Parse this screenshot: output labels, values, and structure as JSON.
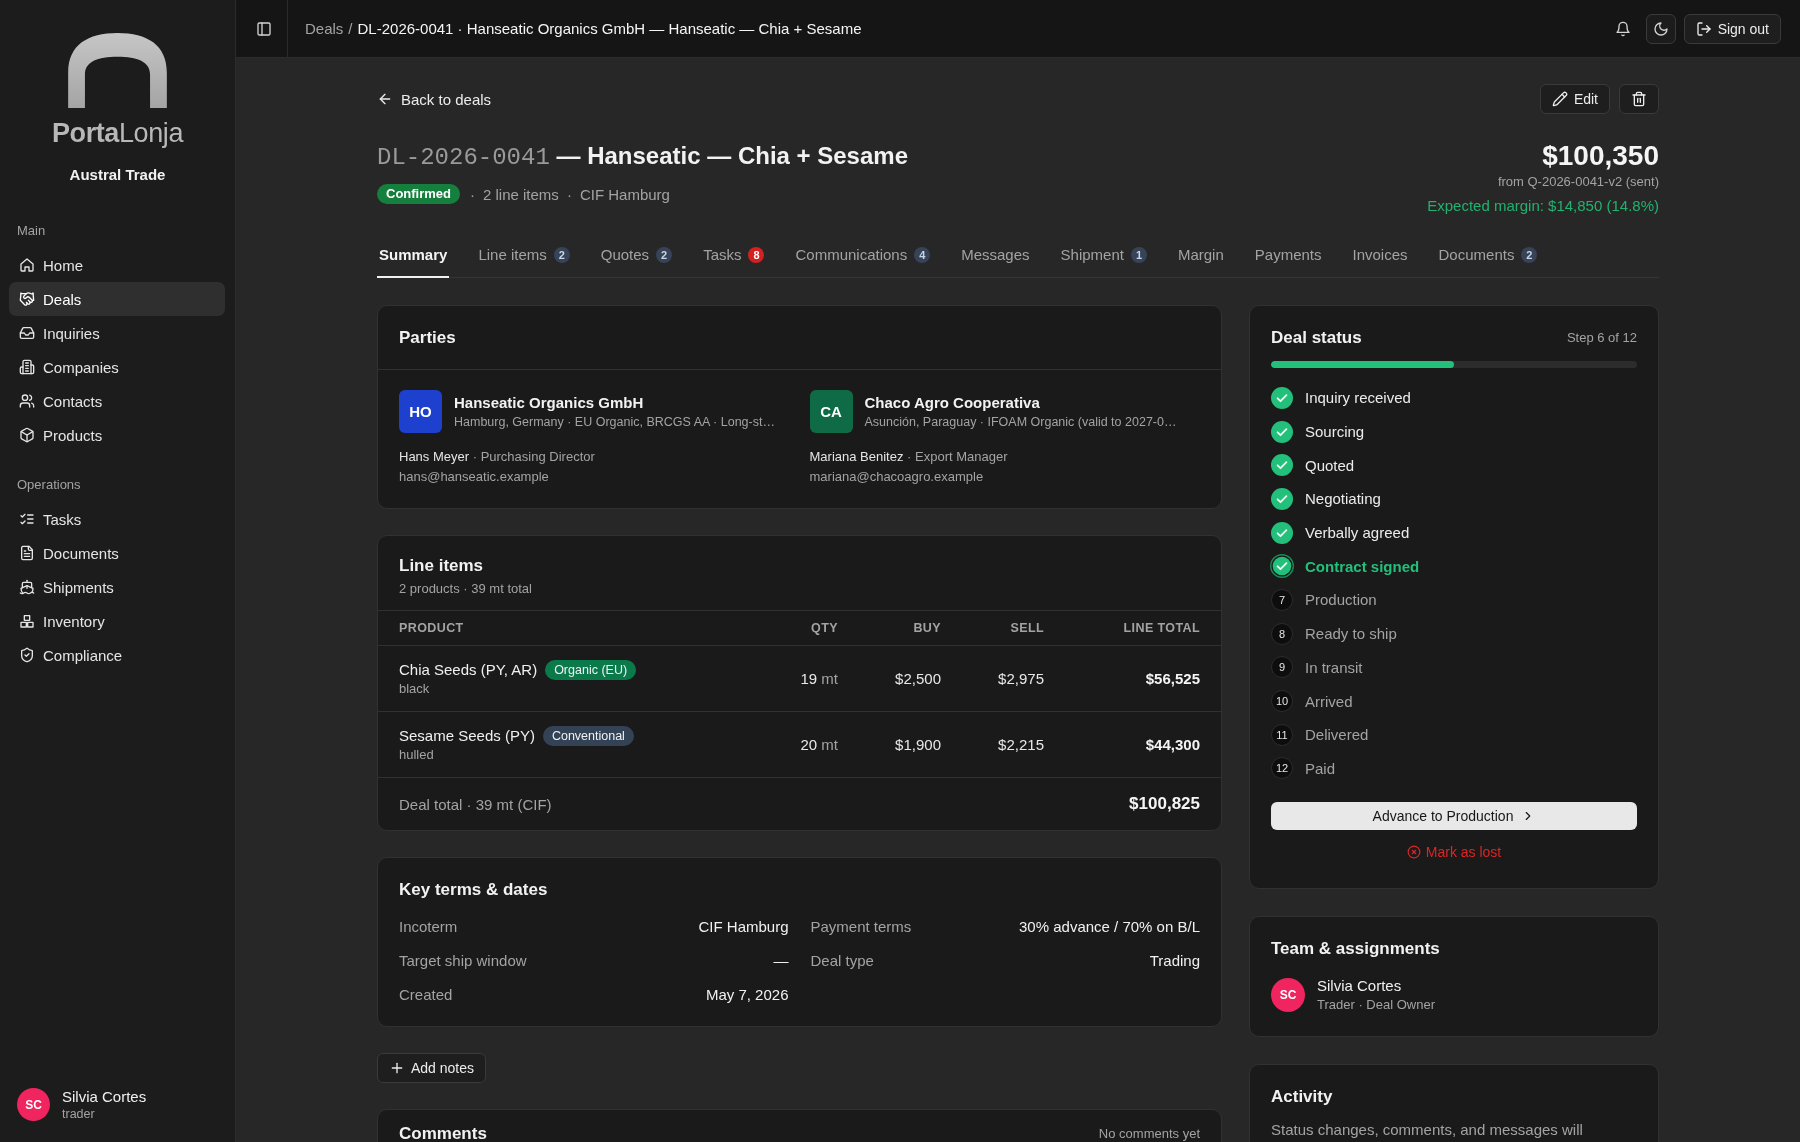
{
  "sidebar": {
    "logo": "**Porta**Lonja",
    "org": "Austral Trade",
    "sections": [
      {
        "title": "Main",
        "items": [
          {
            "label": "Home",
            "selected": false
          },
          {
            "label": "Deals",
            "selected": true
          },
          {
            "label": "Inquiries",
            "selected": false
          },
          {
            "label": "Companies",
            "selected": false
          },
          {
            "label": "Contacts",
            "selected": false
          },
          {
            "label": "Products",
            "selected": false
          }
        ]
      },
      {
        "title": "Operations",
        "items": [
          {
            "label": "Tasks",
            "selected": false
          },
          {
            "label": "Documents",
            "selected": false
          },
          {
            "label": "Shipments",
            "selected": false
          },
          {
            "label": "Inventory",
            "selected": false
          },
          {
            "label": "Compliance",
            "selected": false
          }
        ]
      }
    ],
    "user": {
      "initials": "SC",
      "color": "#f0245e",
      "name": "Silvia Cortes",
      "role": "trader"
    }
  },
  "header": {
    "breadcrumb": {
      "parent": "Deals",
      "separator": "/",
      "current": "DL-2026-0041 · Hanseatic Organics GmbH — Hanseatic — Chia + Sesame"
    },
    "sign_out": "Sign out"
  },
  "deal": {
    "back_link": "Back to deals",
    "edit_button": "Edit",
    "id": "DL-2026-0041",
    "title": "— Hanseatic — Chia + Sesame",
    "status": "Confirmed",
    "meta_separator": "·",
    "meta": [
      "2 line items",
      "CIF Hamburg"
    ],
    "amount": "$100,350",
    "amount_source": "from Q-2026-0041-v2 (sent)",
    "expected_margin": "Expected margin: $14,850 (14.8%)"
  },
  "tabs": [
    {
      "label": "Summary",
      "selected": true
    },
    {
      "label": "Line items",
      "count": "2",
      "count_alert": false,
      "selected": false
    },
    {
      "label": "Quotes",
      "count": "2",
      "count_alert": false,
      "selected": false
    },
    {
      "label": "Tasks",
      "count": "8",
      "count_alert": true,
      "selected": false
    },
    {
      "label": "Communications",
      "count": "4",
      "count_alert": false,
      "selected": false
    },
    {
      "label": "Messages",
      "selected": false
    },
    {
      "label": "Shipment",
      "count": "1",
      "count_alert": false,
      "selected": false
    },
    {
      "label": "Margin",
      "selected": false
    },
    {
      "label": "Payments",
      "selected": false
    },
    {
      "label": "Invoices",
      "selected": false
    },
    {
      "label": "Documents",
      "count": "2",
      "count_alert": false,
      "selected": false
    }
  ],
  "parties": {
    "title": "Parties",
    "items": [
      {
        "initials": "HO",
        "color": "#1e40cf",
        "name": "Hanseatic Organics GmbH",
        "details": "Hamburg, Germany · EU Organic, BRCGS AA · Long-st…",
        "contact": "Hans Meyer",
        "role": "· Purchasing Director",
        "email": "hans@hanseatic.example"
      },
      {
        "initials": "CA",
        "color": "#0f6b45",
        "name": "Chaco Agro Cooperativa",
        "details": "Asunción, Paraguay · IFOAM Organic (valid to 2027-0…",
        "contact": "Mariana Benitez",
        "role": "· Export Manager",
        "email": "mariana@chacoagro.example"
      }
    ]
  },
  "line_items": {
    "title": "Line items",
    "summary": "2 products · 39 mt total",
    "columns": [
      "PRODUCT",
      "QTY",
      "BUY",
      "SELL",
      "LINE TOTAL"
    ],
    "rows": [
      {
        "product": "Chia Seeds (PY, AR)",
        "tag": {
          "label": "Organic (EU)",
          "color": "#0b7a4b"
        },
        "variant": "black",
        "qty": "19",
        "unit": "mt",
        "buy": "$2,500",
        "sell": "$2,975",
        "total": "$56,525"
      },
      {
        "product": "Sesame Seeds (PY)",
        "tag": {
          "label": "Conventional",
          "color": "#344256"
        },
        "variant": "hulled",
        "qty": "20",
        "unit": "mt",
        "buy": "$1,900",
        "sell": "$2,215",
        "total": "$44,300"
      }
    ],
    "footer": {
      "label": "Deal total · 39 mt (CIF)",
      "total": "$100,825"
    }
  },
  "key_terms": {
    "title": "Key terms & dates",
    "fields": [
      {
        "label": "Incoterm",
        "value": "CIF Hamburg"
      },
      {
        "label": "Payment terms",
        "value": "30% advance / 70% on B/L"
      },
      {
        "label": "Target ship window",
        "value": "—"
      },
      {
        "label": "Deal type",
        "value": "Trading"
      },
      {
        "label": "Created",
        "value": "May 7, 2026"
      }
    ]
  },
  "add_notes_button": "Add notes",
  "comments": {
    "title": "Comments",
    "empty": "No comments yet"
  },
  "deal_status": {
    "title": "Deal status",
    "step_label": "Step 6 of 12",
    "level": 0.5,
    "steps": [
      {
        "label": "Inquiry received",
        "done": true,
        "current": false
      },
      {
        "label": "Sourcing",
        "done": true,
        "current": false
      },
      {
        "label": "Quoted",
        "done": true,
        "current": false
      },
      {
        "label": "Negotiating",
        "done": true,
        "current": false
      },
      {
        "label": "Verbally agreed",
        "done": true,
        "current": false
      },
      {
        "label": "Contract signed",
        "done": true,
        "current": true
      },
      {
        "label": "Production",
        "number": "7",
        "done": false,
        "current": false
      },
      {
        "label": "Ready to ship",
        "number": "8",
        "done": false,
        "current": false
      },
      {
        "label": "In transit",
        "number": "9",
        "done": false,
        "current": false
      },
      {
        "label": "Arrived",
        "number": "10",
        "done": false,
        "current": false
      },
      {
        "label": "Delivered",
        "number": "11",
        "done": false,
        "current": false
      },
      {
        "label": "Paid",
        "number": "12",
        "done": false,
        "current": false
      }
    ],
    "advance_button": "Advance to Production",
    "lost_link": "Mark as lost"
  },
  "team": {
    "title": "Team & assignments",
    "members": [
      {
        "initials": "SC",
        "color": "#f0245e",
        "name": "Silvia Cortes",
        "role": "Trader · Deal Owner"
      }
    ]
  },
  "activity": {
    "title": "Activity",
    "text": "Status changes, comments, and messages will"
  }
}
